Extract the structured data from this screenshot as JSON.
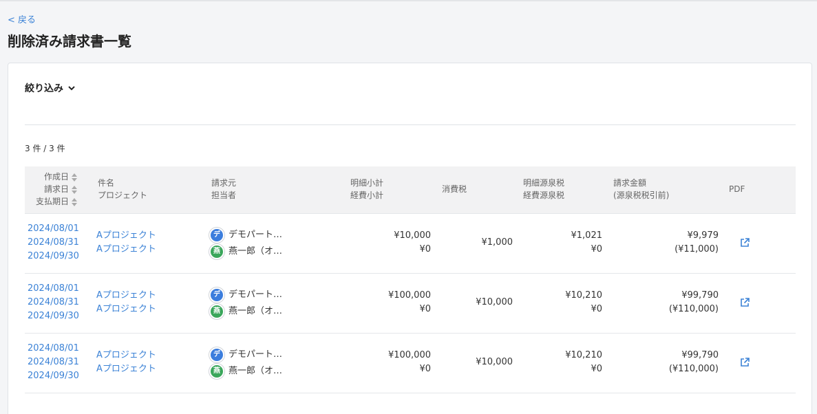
{
  "nav": {
    "back_label": "< 戻る"
  },
  "page": {
    "title": "削除済み請求書一覧"
  },
  "filter": {
    "label": "絞り込み"
  },
  "count_text": "3 件 / 3 件",
  "table": {
    "headers": {
      "dates": [
        "作成日",
        "請求日",
        "支払期日"
      ],
      "subject": [
        "件名",
        "プロジェクト"
      ],
      "issuer": [
        "請求元",
        "担当者"
      ],
      "subtotal": [
        "明細小計",
        "経費小計"
      ],
      "tax": [
        "消費税"
      ],
      "withholding": [
        "明細源泉税",
        "経費源泉税"
      ],
      "amount": [
        "請求金額",
        "(源泉税税引前)"
      ],
      "pdf": [
        "PDF"
      ]
    },
    "rows": [
      {
        "created": "2024/08/01",
        "billed": "2024/08/31",
        "due": "2024/09/30",
        "subject": "Aプロジェクト",
        "project": "Aプロジェクト",
        "issuer_avatar": "デ",
        "issuer": "デモパート…",
        "owner_avatar": "燕",
        "owner": "燕一郎（オ…",
        "item_subtotal": "¥10,000",
        "expense_subtotal": "¥0",
        "tax": "¥1,000",
        "item_withholding": "¥1,021",
        "expense_withholding": "¥0",
        "amount": "¥9,979",
        "amount_pre": "(¥11,000)"
      },
      {
        "created": "2024/08/01",
        "billed": "2024/08/31",
        "due": "2024/09/30",
        "subject": "Aプロジェクト",
        "project": "Aプロジェクト",
        "issuer_avatar": "デ",
        "issuer": "デモパート…",
        "owner_avatar": "燕",
        "owner": "燕一郎（オ…",
        "item_subtotal": "¥100,000",
        "expense_subtotal": "¥0",
        "tax": "¥10,000",
        "item_withholding": "¥10,210",
        "expense_withholding": "¥0",
        "amount": "¥99,790",
        "amount_pre": "(¥110,000)"
      },
      {
        "created": "2024/08/01",
        "billed": "2024/08/31",
        "due": "2024/09/30",
        "subject": "Aプロジェクト",
        "project": "Aプロジェクト",
        "issuer_avatar": "デ",
        "issuer": "デモパート…",
        "owner_avatar": "燕",
        "owner": "燕一郎（オ…",
        "item_subtotal": "¥100,000",
        "expense_subtotal": "¥0",
        "tax": "¥10,000",
        "item_withholding": "¥10,210",
        "expense_withholding": "¥0",
        "amount": "¥99,790",
        "amount_pre": "(¥110,000)"
      }
    ]
  },
  "colors": {
    "link": "#3b82d6",
    "issuer_avatar": "#3b7ddd",
    "owner_avatar": "#3aa65b"
  },
  "icons": {
    "sort": "sort-icon",
    "chevron": "chevron-down-icon",
    "pdf": "external-link-icon"
  }
}
